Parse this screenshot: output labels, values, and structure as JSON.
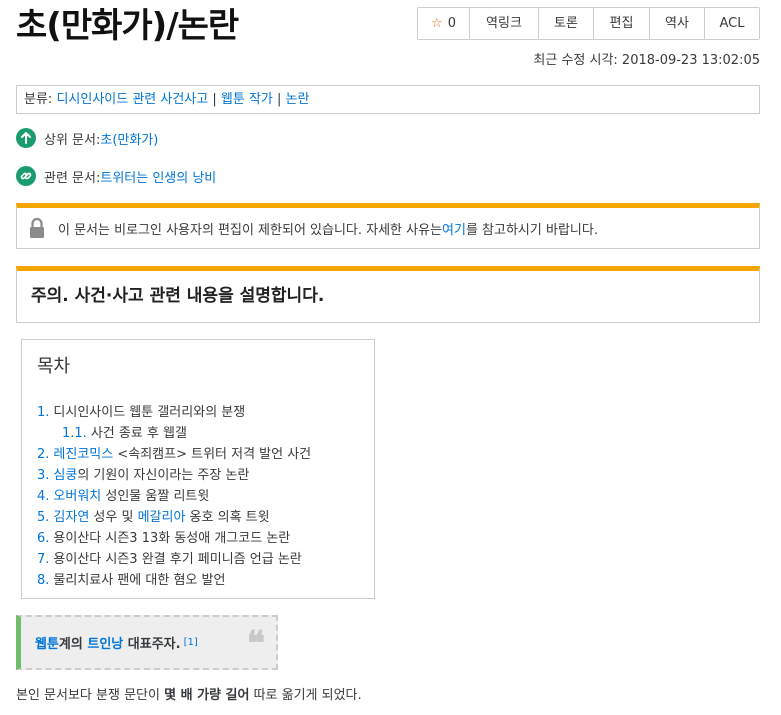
{
  "title": "초(만화가)/논란",
  "actions": {
    "star_count": "0",
    "backlinks": "역링크",
    "discuss": "토론",
    "edit": "편집",
    "history": "역사",
    "acl": "ACL"
  },
  "last_modified": "최근 수정 시각: 2018-09-23 13:02:05",
  "category": {
    "prefix": "분류: ",
    "items": [
      "디시인사이드 관련 사건사고",
      "웹툰 작가",
      "논란"
    ],
    "separator": " | "
  },
  "upper_doc": {
    "label": "상위 문서: ",
    "link": "초(만화가)"
  },
  "related_doc": {
    "label": "관련 문서: ",
    "link": "트위터는 인생의 낭비"
  },
  "notice": {
    "before": "이 문서는 비로그인 사용자의 편집이 제한되어 있습니다. 자세한 사유는 ",
    "link": "여기",
    "after": "를 참고하시기 바랍니다."
  },
  "warning": "주의. 사건·사고 관련 내용을 설명합니다.",
  "toc": {
    "title": "목차",
    "items": [
      {
        "num": "1.",
        "parts": [
          {
            "t": "디시인사이드 웹툰 갤러리와의 분쟁",
            "link": false
          }
        ]
      },
      {
        "num": "1.1.",
        "parts": [
          {
            "t": "사건 종료 후 웹갤",
            "link": false
          }
        ]
      },
      {
        "num": "2.",
        "parts": [
          {
            "t": "레진코믹스",
            "link": true
          },
          {
            "t": " <속죄캠프> 트위터 저격 발언 사건",
            "link": false
          }
        ]
      },
      {
        "num": "3.",
        "parts": [
          {
            "t": "심쿵",
            "link": true
          },
          {
            "t": "의 기원이 자신이라는 주장 논란",
            "link": false
          }
        ]
      },
      {
        "num": "4.",
        "parts": [
          {
            "t": "오버워치",
            "link": true
          },
          {
            "t": " 성인물 움짤 리트윗",
            "link": false
          }
        ]
      },
      {
        "num": "5.",
        "parts": [
          {
            "t": "김자연",
            "link": true
          },
          {
            "t": " 성우 및 ",
            "link": false
          },
          {
            "t": "메갈리아",
            "link": true
          },
          {
            "t": " 옹호 의혹 트윗",
            "link": false
          }
        ]
      },
      {
        "num": "6.",
        "parts": [
          {
            "t": "용이산다 시즌3 13화 동성애 개그코드 논란",
            "link": false
          }
        ]
      },
      {
        "num": "7.",
        "parts": [
          {
            "t": "용이산다 시즌3 완결 후기 페미니즘 언급 논란",
            "link": false
          }
        ]
      },
      {
        "num": "8.",
        "parts": [
          {
            "t": "물리치료사 팬에 대한 혐오 발언",
            "link": false
          }
        ]
      }
    ]
  },
  "quote": {
    "link1": "웹툰",
    "text1": "계의 ",
    "link2": "트인낭",
    "text2": " 대표주자.",
    "ref": "[1]"
  },
  "body": {
    "before": "본인 문서보다 분쟁 문단이 ",
    "bold": "몇 배 가량 길어",
    "after": " 따로 옮기게 되었다."
  },
  "colors": {
    "link": "#0275d8",
    "accent_orange": "#f5a500",
    "green_icon": "#1a9c6d",
    "quote_border": "#71bc6d",
    "star": "#e8641b"
  },
  "icons": [
    "star-icon",
    "arrow-up-icon",
    "link-icon",
    "lock-icon",
    "quote-icon"
  ]
}
